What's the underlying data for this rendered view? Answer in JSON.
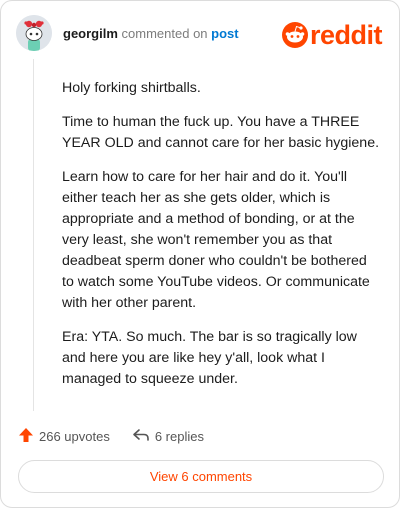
{
  "header": {
    "username": "georgilm",
    "commented_text": "commented on",
    "post_link_text": "post",
    "brand_word": "reddit"
  },
  "comment": {
    "paragraphs": [
      "Holy forking shirtballs.",
      "Time to human the fuck up. You have a THREE YEAR OLD and cannot care for her basic hygiene.",
      "Learn how to care for her hair and do it. You'll either teach her as she gets older, which is appropriate and a method of bonding, or at the very least, she won't remember you as that deadbeat sperm doner who couldn't be bothered to watch some YouTube videos. Or communicate with her other parent.",
      "Era: YTA. So much. The bar is so tragically low and here you are like hey y'all, look what I managed to squeeze under."
    ]
  },
  "actions": {
    "upvotes_label": "266 upvotes",
    "replies_label": "6 replies",
    "upvote_icon": "upvote-arrow-icon",
    "reply_icon": "reply-arrow-icon"
  },
  "footer": {
    "view_comments_label": "View 6 comments"
  },
  "colors": {
    "brand": "#ff4500",
    "link": "#0079d3",
    "muted": "#7c7c7c"
  }
}
